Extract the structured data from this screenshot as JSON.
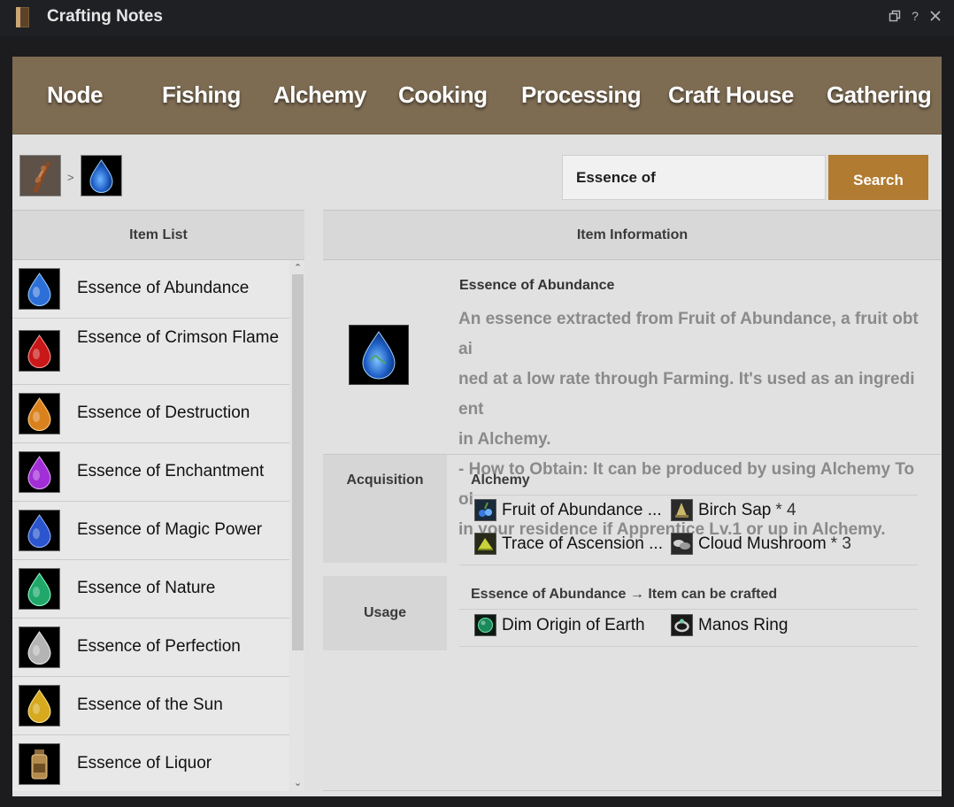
{
  "window": {
    "title": "Crafting Notes"
  },
  "tabs": [
    "Node",
    "Fishing",
    "Alchemy",
    "Cooking",
    "Processing",
    "Craft House",
    "Gathering"
  ],
  "breadcrumb": {
    "separator": ">"
  },
  "search": {
    "value": "Essence of",
    "button_label": "Search"
  },
  "item_list": {
    "header": "Item List",
    "items": [
      {
        "label": "Essence of Abundance",
        "color": "#2d6fd8"
      },
      {
        "label": "Essence of Crimson Flame",
        "color": "#c81818"
      },
      {
        "label": "Essence of Destruction",
        "color": "#d9821d"
      },
      {
        "label": "Essence of Enchantment",
        "color": "#a12ed6"
      },
      {
        "label": "Essence of Magic Power",
        "color": "#2a55cc"
      },
      {
        "label": "Essence of Nature",
        "color": "#1fa86a"
      },
      {
        "label": "Essence of Perfection",
        "color": "#b4b4b4"
      },
      {
        "label": "Essence of the Sun",
        "color": "#d6a91f"
      },
      {
        "label": "Essence of Liquor",
        "color": "#b38b4c"
      }
    ]
  },
  "item_info": {
    "header": "Item Information",
    "name": "Essence of Abundance",
    "description_lines": [
      "An essence extracted from Fruit of Abundance, a fruit obtai",
      "ned at a low rate through Farming. It's used as an ingredient",
      "in Alchemy.",
      "- How to Obtain: It can be produced by using Alchemy Tool",
      "in your residence if Apprentice Lv.1 or up in Alchemy."
    ],
    "acquisition": {
      "label": "Acquisition",
      "method": "Alchemy",
      "materials": [
        {
          "name": "Fruit of Abundance ...",
          "qty": ""
        },
        {
          "name": "Birch Sap",
          "qty": "* 4"
        },
        {
          "name": "Trace of Ascension ...",
          "qty": ""
        },
        {
          "name": "Cloud Mushroom",
          "qty": "* 3"
        }
      ]
    },
    "usage": {
      "label": "Usage",
      "heading": "Essence of Abundance → Item can be crafted",
      "products": [
        {
          "name": "Dim Origin of Earth"
        },
        {
          "name": "Manos Ring"
        }
      ]
    }
  },
  "colors": {
    "tab_bar": "#7d6b52",
    "search_button": "#b17b31",
    "panel": "#e1e1e1"
  }
}
